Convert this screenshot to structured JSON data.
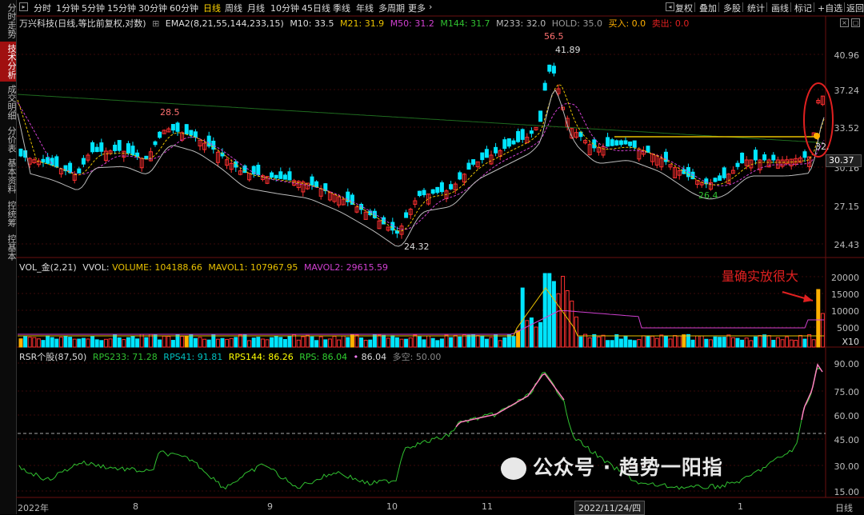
{
  "sidebar": {
    "items": [
      {
        "label": "分时走势",
        "active": false
      },
      {
        "label": "技术分析",
        "active": true
      },
      {
        "label": "成交明细",
        "active": false
      },
      {
        "label": "分价表",
        "active": false
      },
      {
        "label": "基本资料",
        "active": false
      },
      {
        "label": "控统筹",
        "active": false
      },
      {
        "label": "控基本",
        "active": false
      }
    ]
  },
  "period_bar": {
    "periods": [
      "分时",
      "1分钟",
      "5分钟",
      "15分钟",
      "30分钟",
      "60分钟",
      "日线",
      "周线",
      "月线",
      "10分钟",
      "45日线",
      "季线",
      "年线",
      "多周期",
      "更多"
    ],
    "active": "日线",
    "right_buttons": [
      "复权",
      "叠加",
      "多股",
      "统计",
      "画线",
      "标记",
      "+自选",
      "返回"
    ]
  },
  "main_header": {
    "stock": "万兴科技(日线,等比前复权,对数)",
    "indicator": "EMA2(8,21,55,144,233,15)",
    "items": [
      {
        "text": "M10: 33.5",
        "color": "#dddddd"
      },
      {
        "text": "M21: 31.9",
        "color": "#e8c000"
      },
      {
        "text": "M50: 31.2",
        "color": "#d040d0"
      },
      {
        "text": "M144: 31.7",
        "color": "#30c030"
      },
      {
        "text": "M233: 32.0",
        "color": "#bbbbbb"
      },
      {
        "text": "HOLD: 35.0",
        "color": "#999999"
      },
      {
        "text": "买入: 0.0",
        "color": "#ffb000"
      },
      {
        "text": "卖出: 0.0",
        "color": "#e02020"
      }
    ]
  },
  "vol_header": {
    "name": "VOL_金(2,21)",
    "items": [
      {
        "text": "VVOL: ",
        "color": "#dddddd"
      },
      {
        "text": "VOLUME: 104188.66",
        "color": "#e8c000"
      },
      {
        "text": "MAVOL1: 107967.95",
        "color": "#e8c000"
      },
      {
        "text": "MAVOL2: 29615.59",
        "color": "#d040d0"
      }
    ]
  },
  "rsr_header": {
    "name": "RSR个股(87,50)",
    "items": [
      {
        "text": "RPS233: 71.28",
        "color": "#30c030"
      },
      {
        "text": "RPS41: 91.81",
        "color": "#00c0c0"
      },
      {
        "text": "RPS144: 86.26",
        "color": "#ffff00"
      },
      {
        "text": "RPS: 86.04",
        "color": "#30d030"
      },
      {
        "text": "•",
        "color": "#ff80ff"
      },
      {
        "text": "86.04",
        "color": "#dddddd"
      },
      {
        "text": "多空: 50.00",
        "color": "#888888"
      }
    ]
  },
  "price_axis": [
    "40.96",
    "37.24",
    "33.52",
    "30.16",
    "27.15",
    "24.43"
  ],
  "price_flag": "30.37",
  "vol_axis": [
    "20000",
    "15000",
    "10000",
    "5000"
  ],
  "vol_unit": "X10",
  "rsr_axis": [
    "90.00",
    "75.00",
    "60.00",
    "45.00",
    "30.00",
    "15.00"
  ],
  "x_axis": [
    "2022年",
    "8",
    "9",
    "10",
    "11",
    "1"
  ],
  "date_flag": "2022/11/24/四",
  "x_axis_right": "日线",
  "chart_labels": {
    "hi_mark": "56.5",
    "hi_price": "41.89",
    "left_peak": "28.5",
    "low_price": "24.32",
    "low_mark": "24.32",
    "dip": "26.4",
    "right_mark": "32."
  },
  "note": "量确实放很大",
  "watermark": "公众号 · 趋势一阳指",
  "colors": {
    "up": "#ff3030",
    "down": "#00e5ff",
    "signal": "#ffb000",
    "ma_pink": "#d040d0",
    "ma_green": "#30a030",
    "ma_yellow": "#e8c000",
    "rps_pink": "#ff80c0",
    "rps_green": "#30c030",
    "alert": "#e02020"
  },
  "chart_data": {
    "type": "candlestick",
    "price_ticks": [
      40.96,
      37.24,
      33.52,
      30.16,
      27.15,
      24.43
    ],
    "volume_ticks": [
      20000,
      15000,
      10000,
      5000
    ],
    "rps_ticks": [
      90,
      75,
      60,
      45,
      30,
      15
    ],
    "rps_threshold": 50,
    "price_high": 41.89,
    "price_low": 24.32,
    "last_price": 30.37
  }
}
